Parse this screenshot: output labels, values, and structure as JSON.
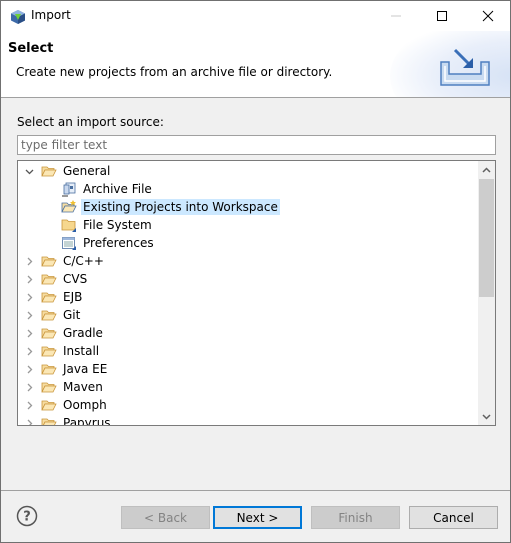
{
  "window": {
    "title": "Import",
    "controls": {
      "minimize": "minimize",
      "maximize": "maximize",
      "close": "close"
    }
  },
  "header": {
    "title": "Select",
    "description": "Create new projects from an archive file or directory.",
    "banner_icon": "import-wizard-icon"
  },
  "source": {
    "label": "Select an import source:",
    "filter": {
      "value": "",
      "placeholder": "type filter text"
    }
  },
  "tree": {
    "items": [
      {
        "label": "General",
        "level": 0,
        "expanded": true,
        "icon": "folder-open-icon"
      },
      {
        "label": "Archive File",
        "level": 1,
        "icon": "archive-file-icon"
      },
      {
        "label": "Existing Projects into Workspace",
        "level": 1,
        "icon": "existing-projects-icon",
        "selected": true
      },
      {
        "label": "File System",
        "level": 1,
        "icon": "file-system-icon"
      },
      {
        "label": "Preferences",
        "level": 1,
        "icon": "preferences-icon"
      },
      {
        "label": "C/C++",
        "level": 0,
        "expanded": false,
        "icon": "folder-icon"
      },
      {
        "label": "CVS",
        "level": 0,
        "expanded": false,
        "icon": "folder-icon"
      },
      {
        "label": "EJB",
        "level": 0,
        "expanded": false,
        "icon": "folder-icon"
      },
      {
        "label": "Git",
        "level": 0,
        "expanded": false,
        "icon": "folder-icon"
      },
      {
        "label": "Gradle",
        "level": 0,
        "expanded": false,
        "icon": "folder-icon"
      },
      {
        "label": "Install",
        "level": 0,
        "expanded": false,
        "icon": "folder-icon"
      },
      {
        "label": "Java EE",
        "level": 0,
        "expanded": false,
        "icon": "folder-icon"
      },
      {
        "label": "Maven",
        "level": 0,
        "expanded": false,
        "icon": "folder-icon"
      },
      {
        "label": "Oomph",
        "level": 0,
        "expanded": false,
        "icon": "folder-icon"
      },
      {
        "label": "Papyrus",
        "level": 0,
        "expanded": false,
        "icon": "folder-icon"
      }
    ],
    "scroll_fraction_visible": 0.45
  },
  "footer": {
    "help_icon": "help-icon",
    "back_label": "< Back",
    "next_label": "Next >",
    "finish_label": "Finish",
    "cancel_label": "Cancel",
    "back_enabled": false,
    "finish_enabled": false
  },
  "colors": {
    "selection": "#cce8ff",
    "default_button_border": "#0078d7",
    "folder": "#e8b85a"
  }
}
